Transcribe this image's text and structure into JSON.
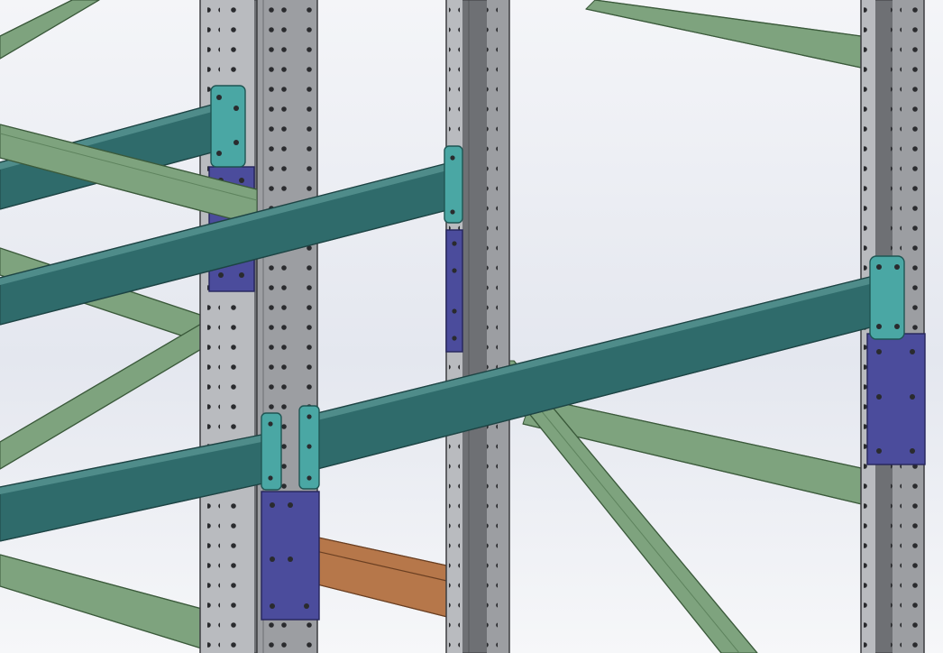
{
  "viewport": {
    "description_label": "",
    "background": {
      "top": "#f4f5f8",
      "mid": "#e4e7ef",
      "bottom": "#f6f7f9"
    }
  },
  "colors": {
    "upright_face": "#9c9ea2",
    "upright_side": "#6e7074",
    "upright_edge": "#3c3d40",
    "upright_light": "#b9bbbf",
    "hole": "#2a2b2e",
    "beam_teal": "#2f6b6b",
    "beam_teal_top": "#4f8c8a",
    "beam_edge": "#1d4444",
    "bracing_green": "#7ea37e",
    "bracing_green_dark": "#5e835e",
    "bracing_edge": "#3b5a3b",
    "connector_cyan": "#4aa7a4",
    "connector_cyan_edge": "#1f5553",
    "plate_blue": "#4b4c9c",
    "plate_blue_edge": "#24245a",
    "beam_orange": "#b6774a",
    "beam_orange_edge": "#6a3f22"
  },
  "parts": {
    "uprights": [
      "upright-left",
      "upright-middle",
      "upright-right"
    ],
    "beams": [
      "beam-upper-left",
      "beam-middle-left",
      "beam-lower-long",
      "beam-right-upper",
      "beam-orange-back"
    ],
    "bracing": [
      "brace-top-right",
      "brace-left-upper",
      "brace-left-cross",
      "brace-left-lower",
      "brace-right-diagonal",
      "brace-right-horizontal",
      "brace-bottom-left"
    ],
    "connectors": [
      "connector-left-top",
      "connector-middle-top",
      "connector-left-lower-a",
      "connector-left-lower-b",
      "connector-right"
    ],
    "base_plates": [
      "plate-left-top",
      "plate-middle",
      "plate-left-lower",
      "plate-right"
    ]
  }
}
